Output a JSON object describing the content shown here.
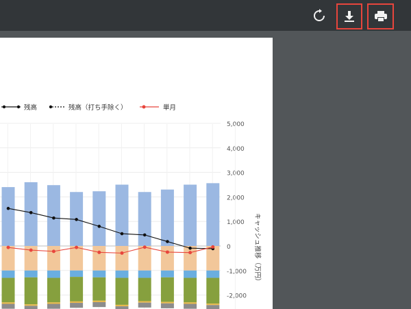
{
  "toolbar": {
    "rotate_icon": "rotate-icon",
    "download_icon": "download-icon",
    "print_icon": "print-icon",
    "highlight_color": "#e8453c"
  },
  "chart_data": {
    "type": "bar",
    "legend": [
      "残高",
      "残高（打ち手除く）",
      "単月"
    ],
    "legend_position": "top",
    "y_axis_label": "キャッシュ推移（万円）",
    "y_axis_position": "right",
    "yticks": [
      "5,000",
      "4,000",
      "3,000",
      "2,000",
      "1,000",
      "0",
      "-1,000",
      "-2,000"
    ],
    "ylim": [
      -2500,
      5000
    ],
    "grid": true,
    "categories_count": 10,
    "series": [
      {
        "name": "",
        "color": "#9bb8e2",
        "values": [
          2400,
          2600,
          2480,
          2200,
          2230,
          2500,
          2200,
          2300,
          2500,
          2560
        ]
      },
      {
        "name": "",
        "color": "#f2c79a",
        "values": [
          -1000,
          -1000,
          -1000,
          -1000,
          -1000,
          -1000,
          -1000,
          -1000,
          -1000,
          -1000
        ]
      },
      {
        "name": "",
        "color": "#6aaee0",
        "values": [
          -300,
          -280,
          -300,
          -260,
          -280,
          -300,
          -300,
          -280,
          -300,
          -300
        ]
      },
      {
        "name": "",
        "color": "#86a03e",
        "values": [
          -1000,
          -1100,
          -1000,
          -1000,
          -950,
          -1100,
          -950,
          -1000,
          -1000,
          -1050
        ]
      },
      {
        "name": "",
        "color": "#e8b84a",
        "values": [
          -60,
          -60,
          -60,
          -60,
          -60,
          -60,
          -60,
          -60,
          -60,
          -60
        ]
      },
      {
        "name": "",
        "color": "#8c8c8c",
        "values": [
          -200,
          -200,
          -200,
          -200,
          -200,
          -200,
          -200,
          -200,
          -200,
          -200
        ]
      }
    ],
    "line_balance": {
      "name": "残高",
      "color": "#111111",
      "values": [
        1530,
        1360,
        1140,
        1080,
        800,
        500,
        450,
        180,
        -90,
        -110
      ]
    },
    "line_balance_excl": {
      "name": "残高（打ち手除く）",
      "color": "#111111",
      "values": [
        1530,
        1360,
        1140,
        1080,
        800,
        500,
        450,
        180,
        -90,
        -110
      ]
    },
    "line_monthly": {
      "name": "単月",
      "color": "#e8453c",
      "values": [
        -60,
        -170,
        -220,
        -60,
        -260,
        -290,
        -50,
        -250,
        -270,
        -40
      ]
    }
  }
}
